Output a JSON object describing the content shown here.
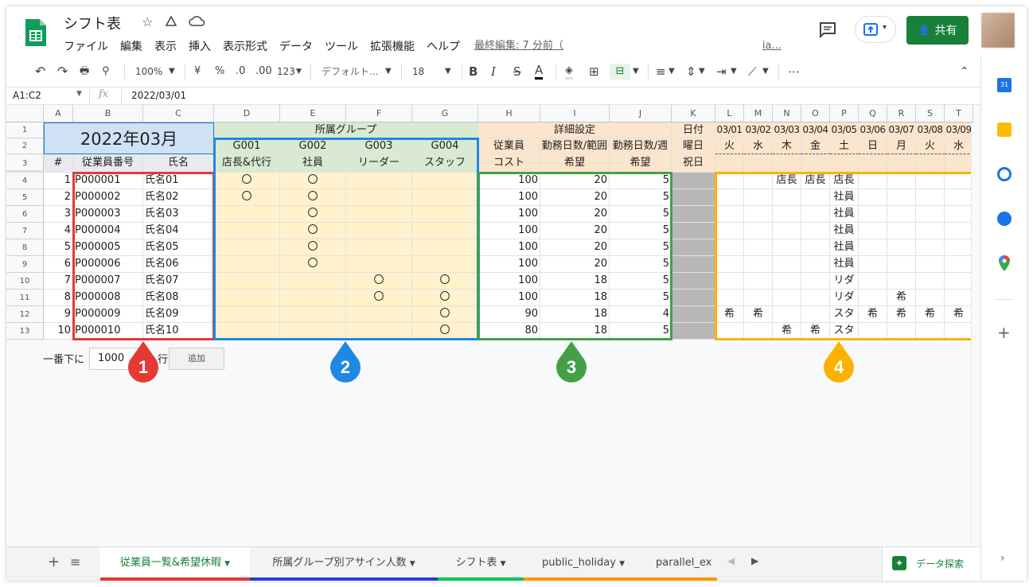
{
  "doc": {
    "title": "シフト表",
    "menus": [
      "ファイル",
      "編集",
      "表示",
      "挿入",
      "表示形式",
      "データ",
      "ツール",
      "拡張機能",
      "ヘルプ"
    ],
    "last_edit": "最終編集: 7 分前（",
    "last_edit_tail": "ia...",
    "share": "共有"
  },
  "toolbar": {
    "zoom": "100%",
    "currency": "¥",
    "percent": "%",
    "dec_less": ".0",
    "dec_more": ".00",
    "format123": "123",
    "font": "デフォルト...",
    "size": "18",
    "bold": "B",
    "italic": "I",
    "strike": "S",
    "textcolor": "A"
  },
  "formula": {
    "range": "A1:C2",
    "fx": "fx",
    "value": "2022/03/01"
  },
  "cols": [
    "A",
    "B",
    "C",
    "D",
    "E",
    "F",
    "G",
    "H",
    "I",
    "J",
    "K",
    "L",
    "M",
    "N",
    "O",
    "P",
    "Q",
    "R",
    "S",
    "T"
  ],
  "rows": [
    "1",
    "2",
    "3",
    "4",
    "5",
    "6",
    "7",
    "8",
    "9",
    "10",
    "11",
    "12",
    "13"
  ],
  "sheet": {
    "title": "2022年03月",
    "group_title": "所属グループ",
    "detail_title": "詳細設定",
    "date_label": "日付",
    "weekday_label": "曜日",
    "holiday_label": "祝日",
    "groups": [
      "G001",
      "G002",
      "G003",
      "G004"
    ],
    "group_roles": [
      "店長&代行",
      "社員",
      "リーダー",
      "スタッフ"
    ],
    "col_no": "#",
    "col_id": "従業員番号",
    "col_name": "氏名",
    "detail_h2": [
      "従業員",
      "勤務日数/範囲",
      "勤務日数/週"
    ],
    "detail_h3": [
      "コスト",
      "希望",
      "希望"
    ],
    "dates": [
      "03/01",
      "03/02",
      "03/03",
      "03/04",
      "03/05",
      "03/06",
      "03/07",
      "03/08",
      "03/09"
    ],
    "weekdays": [
      "火",
      "水",
      "木",
      "金",
      "土",
      "日",
      "月",
      "火",
      "水"
    ],
    "employees": [
      {
        "no": "1",
        "id": "P000001",
        "name": "氏名01",
        "g": [
          "〇",
          "〇",
          "",
          ""
        ],
        "cost": "100",
        "range": "20",
        "week": "5",
        "req": [
          "",
          "",
          "店長",
          "店長",
          "店長",
          "",
          "",
          "",
          ""
        ]
      },
      {
        "no": "2",
        "id": "P000002",
        "name": "氏名02",
        "g": [
          "〇",
          "〇",
          "",
          ""
        ],
        "cost": "100",
        "range": "20",
        "week": "5",
        "req": [
          "",
          "",
          "",
          "",
          "社員",
          "",
          "",
          "",
          ""
        ]
      },
      {
        "no": "3",
        "id": "P000003",
        "name": "氏名03",
        "g": [
          "",
          "〇",
          "",
          ""
        ],
        "cost": "100",
        "range": "20",
        "week": "5",
        "req": [
          "",
          "",
          "",
          "",
          "社員",
          "",
          "",
          "",
          ""
        ]
      },
      {
        "no": "4",
        "id": "P000004",
        "name": "氏名04",
        "g": [
          "",
          "〇",
          "",
          ""
        ],
        "cost": "100",
        "range": "20",
        "week": "5",
        "req": [
          "",
          "",
          "",
          "",
          "社員",
          "",
          "",
          "",
          ""
        ]
      },
      {
        "no": "5",
        "id": "P000005",
        "name": "氏名05",
        "g": [
          "",
          "〇",
          "",
          ""
        ],
        "cost": "100",
        "range": "20",
        "week": "5",
        "req": [
          "",
          "",
          "",
          "",
          "社員",
          "",
          "",
          "",
          ""
        ]
      },
      {
        "no": "6",
        "id": "P000006",
        "name": "氏名06",
        "g": [
          "",
          "〇",
          "",
          ""
        ],
        "cost": "100",
        "range": "20",
        "week": "5",
        "req": [
          "",
          "",
          "",
          "",
          "社員",
          "",
          "",
          "",
          ""
        ]
      },
      {
        "no": "7",
        "id": "P000007",
        "name": "氏名07",
        "g": [
          "",
          "",
          "〇",
          "〇"
        ],
        "cost": "100",
        "range": "18",
        "week": "5",
        "req": [
          "",
          "",
          "",
          "",
          "リダ",
          "",
          "",
          "",
          ""
        ]
      },
      {
        "no": "8",
        "id": "P000008",
        "name": "氏名08",
        "g": [
          "",
          "",
          "〇",
          "〇"
        ],
        "cost": "100",
        "range": "18",
        "week": "5",
        "req": [
          "",
          "",
          "",
          "",
          "リダ",
          "",
          "希",
          "",
          ""
        ]
      },
      {
        "no": "9",
        "id": "P000009",
        "name": "氏名09",
        "g": [
          "",
          "",
          "",
          "〇"
        ],
        "cost": "90",
        "range": "18",
        "week": "4",
        "req": [
          "希",
          "希",
          "",
          "",
          "スタ",
          "希",
          "希",
          "希",
          "希"
        ]
      },
      {
        "no": "10",
        "id": "P000010",
        "name": "氏名10",
        "g": [
          "",
          "",
          "",
          "〇"
        ],
        "cost": "80",
        "range": "18",
        "week": "5",
        "req": [
          "",
          "",
          "希",
          "希",
          "スタ",
          "",
          "",
          "",
          ""
        ]
      }
    ],
    "append_prefix": "一番下に",
    "append_value": "1000",
    "append_suffix": "行",
    "append_button": "追加"
  },
  "pins": [
    "1",
    "2",
    "3",
    "4"
  ],
  "pin_colors": [
    "#e53935",
    "#1e88e5",
    "#43a047",
    "#fbb300"
  ],
  "tabs": {
    "items": [
      "従業員一覧&希望休暇",
      "所属グループ別アサイン人数",
      "シフト表",
      "public_holiday",
      "parallel_ex"
    ],
    "explore": "データ探索"
  }
}
